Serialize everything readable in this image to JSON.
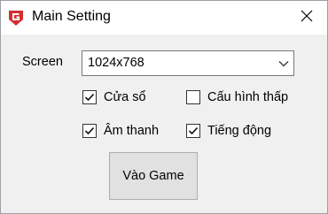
{
  "window": {
    "title": "Main Setting",
    "icon": "gamepad-shield-icon",
    "close_icon": "close-icon"
  },
  "screen": {
    "label": "Screen",
    "selected": "1024x768"
  },
  "options": [
    {
      "label": "Cửa sổ",
      "checked": true
    },
    {
      "label": "Cấu hình thấp",
      "checked": false
    },
    {
      "label": "Âm thanh",
      "checked": true
    },
    {
      "label": "Tiếng động",
      "checked": true
    }
  ],
  "actions": {
    "play_label": "Vào Game"
  },
  "colors": {
    "icon_red": "#d32f2f",
    "button_bg": "#e1e1e1"
  }
}
